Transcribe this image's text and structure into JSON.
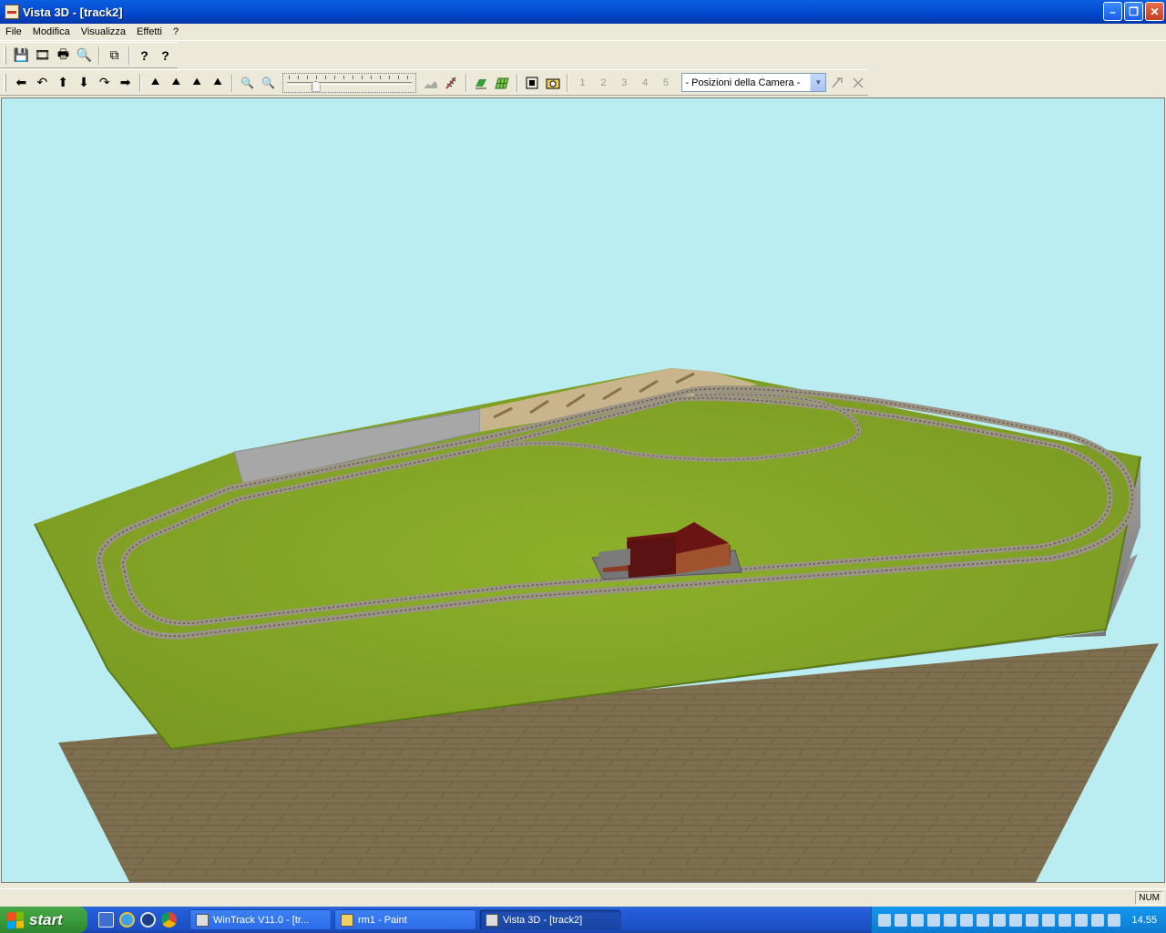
{
  "window": {
    "title": "Vista 3D - [track2]"
  },
  "menu": [
    "File",
    "Modifica",
    "Visualizza",
    "Effetti",
    "?"
  ],
  "toolbar1": [
    {
      "name": "save-icon",
      "glyph": "💾"
    },
    {
      "name": "film-icon",
      "glyph": "🎞"
    },
    {
      "name": "print-icon",
      "glyph": "🖶"
    },
    {
      "name": "print-preview-icon",
      "glyph": "🔍"
    },
    {
      "name": "copy-icon",
      "glyph": "⧉"
    },
    {
      "name": "help-icon",
      "glyph": "?"
    },
    {
      "name": "context-help-icon",
      "glyph": "?"
    }
  ],
  "toolbar2": {
    "nav": [
      {
        "name": "move-left-icon",
        "glyph": "⬅"
      },
      {
        "name": "rotate-left-icon",
        "glyph": "↶"
      },
      {
        "name": "move-up-icon",
        "glyph": "⬆"
      },
      {
        "name": "move-down-icon",
        "glyph": "⬇"
      },
      {
        "name": "rotate-right-icon",
        "glyph": "↷"
      },
      {
        "name": "move-right-icon",
        "glyph": "➡"
      }
    ],
    "view": [
      {
        "name": "camera-up-icon",
        "glyph": "⛰"
      },
      {
        "name": "camera-tilt-up-icon",
        "glyph": "⛰"
      },
      {
        "name": "camera-tilt-down-icon",
        "glyph": "⛰"
      },
      {
        "name": "camera-down-icon",
        "glyph": "⛰"
      }
    ],
    "zoom_out_glyph": "🔍",
    "zoom_in_glyph": "🔍",
    "zoom_level": 0.2,
    "camera_slots": [
      "1",
      "2",
      "3",
      "4",
      "5"
    ],
    "camera_select_value": "- Posizioni della Camera -"
  },
  "status": {
    "num": "NUM"
  },
  "taskbar": {
    "start_label": "start",
    "tasks": [
      {
        "label": "WinTrack  V11.0 - [tr...",
        "active": false
      },
      {
        "label": "rm1 - Paint",
        "active": false
      },
      {
        "label": "Vista 3D - [track2]",
        "active": true
      }
    ],
    "clock": "14.55"
  },
  "colors": {
    "sky": "#b9edf1",
    "grass": "#86a928",
    "cliff": "#7d7d7d",
    "floor": "#7d6f4f",
    "building_roof": "#6b1414",
    "building_wall": "#8a3c26"
  }
}
